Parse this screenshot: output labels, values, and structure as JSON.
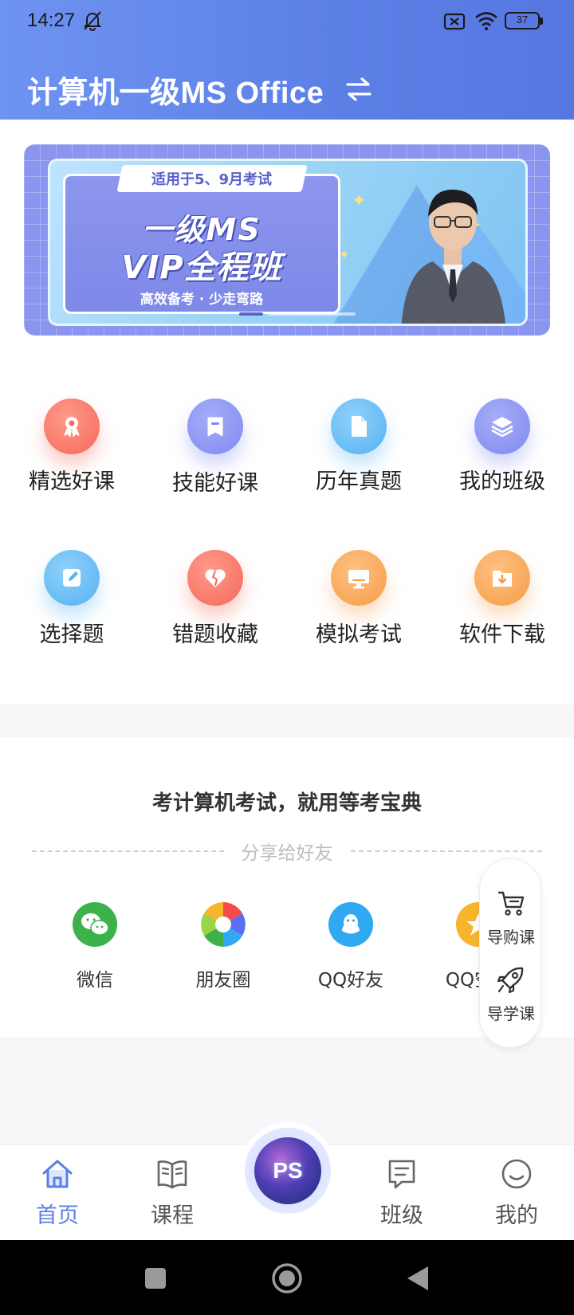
{
  "status_bar": {
    "time": "14:27",
    "battery": "37"
  },
  "header": {
    "title": "计算机一级MS Office"
  },
  "banner": {
    "tag": "适用于5、9月考试",
    "headline_1": "一级MS",
    "headline_2": "VIP全程班",
    "subtitle": "高效备考 · 少走弯路"
  },
  "grid": {
    "items": [
      {
        "label": "精选好课",
        "icon": "award-icon",
        "color": "#f4695a"
      },
      {
        "label": "技能好课",
        "icon": "bookmark-icon",
        "color": "#7f8af0"
      },
      {
        "label": "历年真题",
        "icon": "document-icon",
        "color": "#56b2f0"
      },
      {
        "label": "我的班级",
        "icon": "layers-icon",
        "color": "#7f8af0"
      },
      {
        "label": "选择题",
        "icon": "edit-icon",
        "color": "#56b2f0"
      },
      {
        "label": "错题收藏",
        "icon": "heart-icon",
        "color": "#f4695a"
      },
      {
        "label": "模拟考试",
        "icon": "monitor-icon",
        "color": "#f59d4a"
      },
      {
        "label": "软件下载",
        "icon": "download-folder-icon",
        "color": "#f59d4a"
      }
    ]
  },
  "share": {
    "slogan": "考计算机考试，就用等考宝典",
    "divider_text": "分享给好友",
    "items": [
      {
        "label": "微信",
        "icon": "wechat-icon",
        "color": "#3db24b"
      },
      {
        "label": "朋友圈",
        "icon": "moments-icon",
        "color": "#ffffff"
      },
      {
        "label": "QQ好友",
        "icon": "qq-icon",
        "color": "#2fa9f2"
      },
      {
        "label": "QQ空间",
        "icon": "qzone-icon",
        "color": "#f6b52c"
      }
    ]
  },
  "float_panel": {
    "buy_label": "导购课",
    "learn_label": "导学课"
  },
  "bottom_nav": {
    "home": "首页",
    "courses": "课程",
    "center": "PS",
    "class": "班级",
    "mine": "我的"
  },
  "colors": {
    "accent": "#5b7fe6",
    "header_start": "#6f93f2",
    "header_end": "#5677e0"
  }
}
